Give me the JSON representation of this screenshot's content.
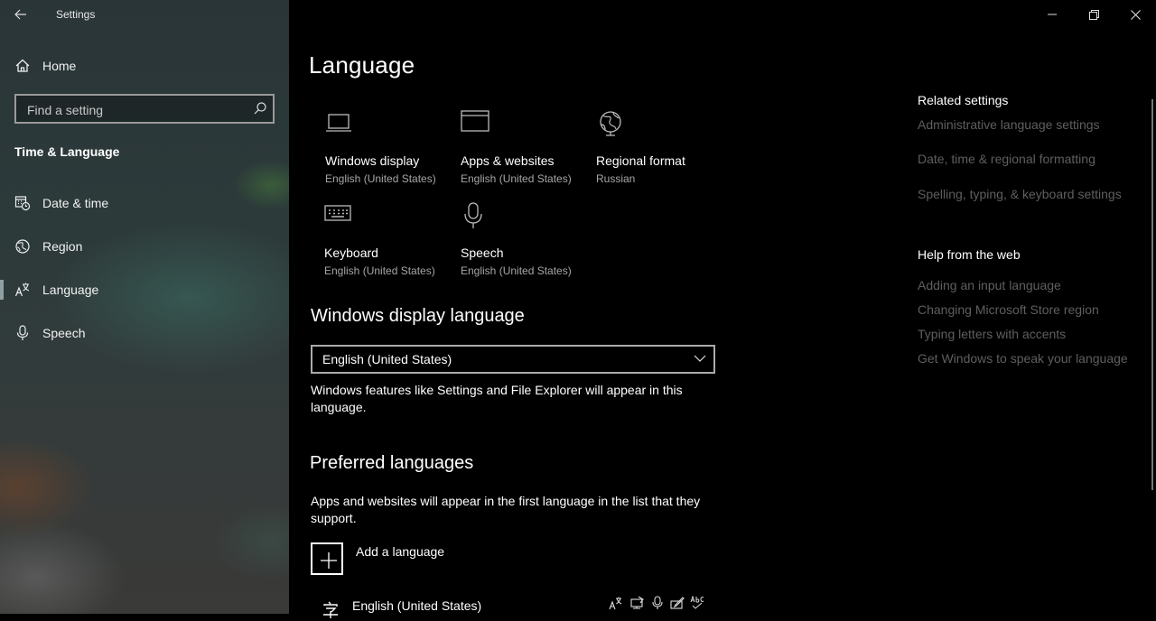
{
  "window": {
    "app_title": "Settings",
    "controls": [
      "minimize",
      "restore",
      "close"
    ]
  },
  "sidebar": {
    "home_label": "Home",
    "search_placeholder": "Find a setting",
    "section_title": "Time & Language",
    "items": [
      {
        "label": "Date & time",
        "icon": "calendar-clock-icon"
      },
      {
        "label": "Region",
        "icon": "globe-icon"
      },
      {
        "label": "Language",
        "icon": "language-icon",
        "active": true
      },
      {
        "label": "Speech",
        "icon": "microphone-icon"
      }
    ]
  },
  "main": {
    "page_title": "Language",
    "tiles": [
      {
        "name": "Windows display",
        "value": "English (United States)",
        "icon": "laptop-icon"
      },
      {
        "name": "Apps & websites",
        "value": "English (United States)",
        "icon": "browser-window-icon"
      },
      {
        "name": "Regional format",
        "value": "Russian",
        "icon": "regional-globe-icon"
      },
      {
        "name": "Keyboard",
        "value": "English (United States)",
        "icon": "keyboard-icon"
      },
      {
        "name": "Speech",
        "value": "English (United States)",
        "icon": "microphone-icon"
      }
    ],
    "display_language": {
      "heading": "Windows display language",
      "selected": "English (United States)",
      "description_line1": "Windows features like Settings and File Explorer will appear in this",
      "description_line2": "language."
    },
    "preferred": {
      "heading": "Preferred languages",
      "description_line1": "Apps and websites will appear in the first language in the list that they",
      "description_line2": "support.",
      "add_label": "Add a language",
      "languages": [
        {
          "label": "English (United States)",
          "features": [
            "display-language-icon",
            "text-to-speech-icon",
            "speech-recognition-icon",
            "handwriting-icon",
            "spellcheck-icon"
          ]
        }
      ]
    }
  },
  "related": {
    "heading": "Related settings",
    "links": [
      "Administrative language settings",
      "Date, time & regional formatting",
      "Spelling, typing, & keyboard settings"
    ]
  },
  "help": {
    "heading": "Help from the web",
    "links": [
      "Adding an input language",
      "Changing Microsoft Store region",
      "Typing letters with accents",
      "Get Windows to speak your language"
    ]
  },
  "colors": {
    "background": "#000000",
    "link_muted": "#5f5f5f",
    "secondary_text": "#a6a6a6",
    "accent_bar": "#8fa0a4"
  }
}
